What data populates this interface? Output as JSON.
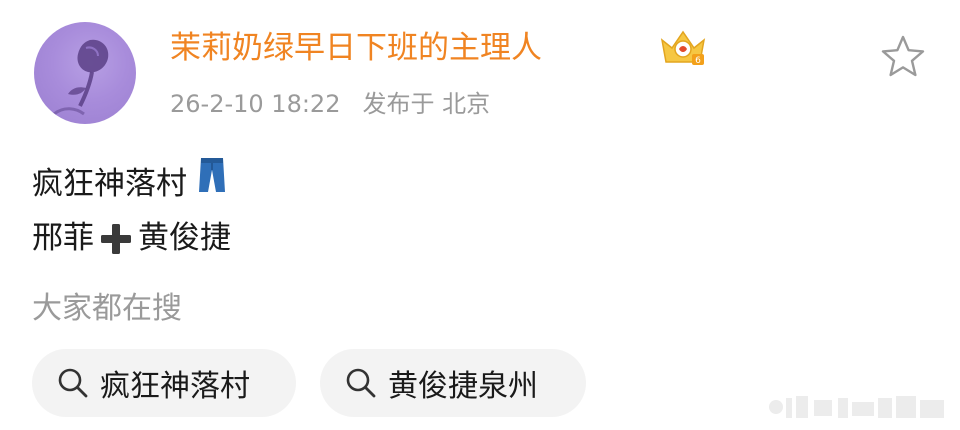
{
  "post": {
    "author": "茉莉奶绿早日下班的主理人",
    "badge_icon": "crown-badge-icon",
    "timestamp": "26-2-10 18:22",
    "location": "发布于 北京",
    "content_line1": "疯狂神落村",
    "content_line1_emoji": "👖",
    "content_line2_a": "邢菲",
    "content_line2_b": "黄俊捷",
    "favorite_icon": "star-outline-icon"
  },
  "search_section": {
    "title": "大家都在搜",
    "chips": [
      {
        "label": "疯狂神落村",
        "icon": "search-icon"
      },
      {
        "label": "黄俊捷泉州",
        "icon": "search-icon"
      }
    ]
  },
  "colors": {
    "author": "#f08422",
    "meta": "#9a9a9a",
    "chip_bg": "#f3f3f3",
    "avatar": "#a88cdb"
  }
}
